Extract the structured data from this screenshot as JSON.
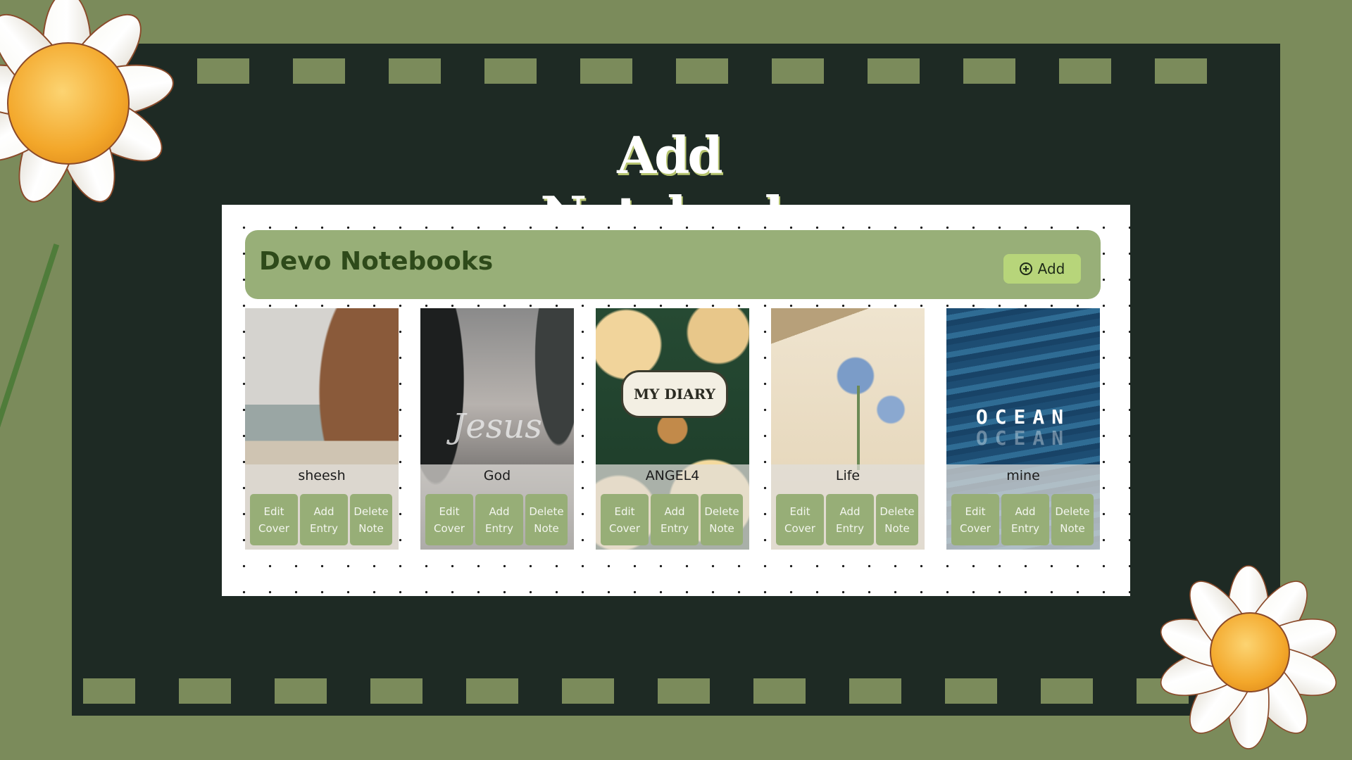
{
  "page": {
    "title": "Add Notebook"
  },
  "panel": {
    "header_title": "Devo Notebooks",
    "add_button_label": "Add"
  },
  "notebooks": [
    {
      "name": "sheesh",
      "cover_text": ""
    },
    {
      "name": "God",
      "cover_text": "Jesus"
    },
    {
      "name": "ANGEL4",
      "cover_text": "MY DIARY"
    },
    {
      "name": "Life",
      "cover_text": ""
    },
    {
      "name": "mine",
      "cover_text": "OCEAN"
    }
  ],
  "card_actions": {
    "edit_cover": "Edit Cover",
    "add_entry": "Add Entry",
    "delete_note": "Delete Note"
  },
  "colors": {
    "background": "#7b8b5b",
    "board": "#1e2a24",
    "header_bar": "#98af78",
    "add_button": "#b7d57a",
    "card_button": "#97ae77",
    "header_text": "#2e4a1a"
  },
  "icons": {
    "add_button_icon": "plus-circle-icon",
    "decor": "daisy-flower"
  }
}
